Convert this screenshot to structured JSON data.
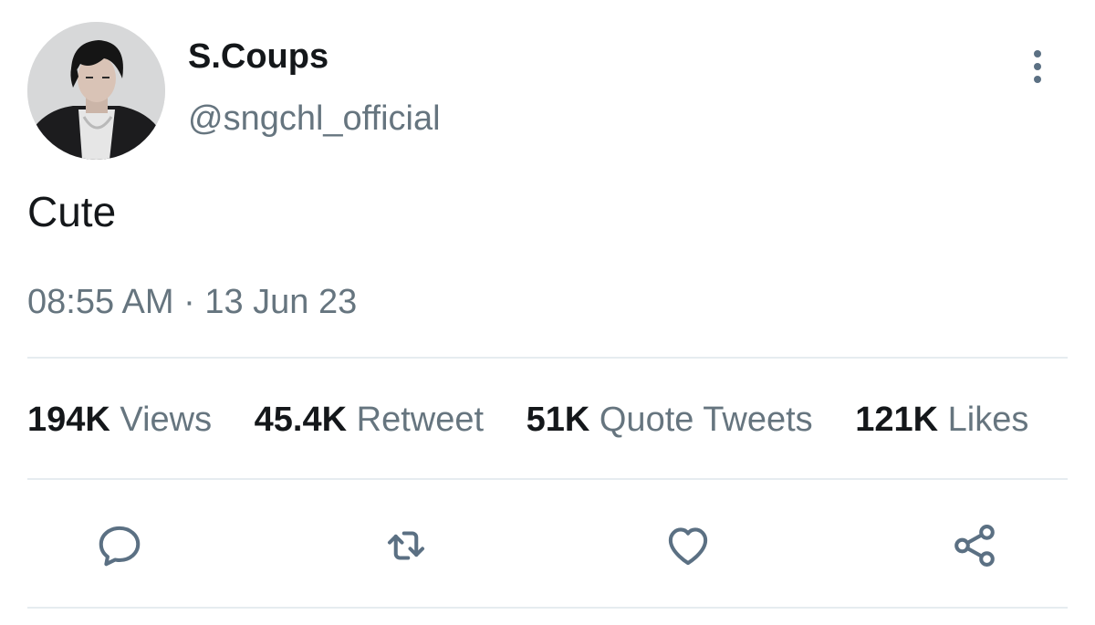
{
  "tweet": {
    "display_name": "S.Coups",
    "handle": "@sngchl_official",
    "text": "Cute",
    "timestamp": "08:55 AM · 13 Jun 23"
  },
  "stats": [
    {
      "value": "194K",
      "label": "Views"
    },
    {
      "value": "45.4K",
      "label": "Retweet"
    },
    {
      "value": "51K",
      "label": "Quote Tweets"
    },
    {
      "value": "121K",
      "label": "Likes"
    }
  ],
  "actions": {
    "reply_icon": "speech-bubble-icon",
    "retweet_icon": "retweet-arrows-icon",
    "like_icon": "heart-icon",
    "share_icon": "share-nodes-icon"
  },
  "colors": {
    "secondary_text": "#66757f",
    "icon": "#5b7083",
    "divider": "#e6ecf0"
  }
}
